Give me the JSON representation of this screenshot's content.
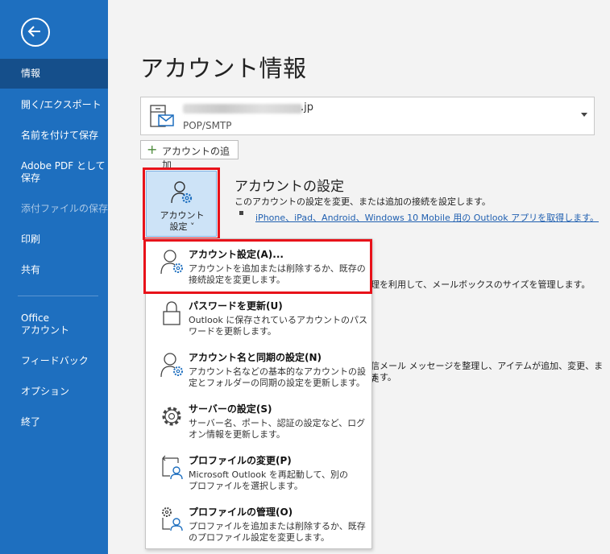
{
  "sidebar": {
    "items": [
      {
        "label": "情報"
      },
      {
        "label": "開く/エクスポート"
      },
      {
        "label": "名前を付けて保存"
      },
      {
        "label": "Adobe PDF として",
        "label2": "保存"
      },
      {
        "label": "添付ファイルの保存"
      },
      {
        "label": "印刷"
      },
      {
        "label": "共有"
      },
      {
        "label": "Office",
        "label2": "アカウント"
      },
      {
        "label": "フィードバック"
      },
      {
        "label": "オプション"
      },
      {
        "label": "終了"
      }
    ]
  },
  "main": {
    "title": "アカウント情報",
    "account": {
      "email_suffix": ".jp",
      "type": "POP/SMTP"
    },
    "add_account": "アカウントの追加",
    "settings_button": {
      "line1": "アカウント",
      "line2": "設定 ˅"
    },
    "section": {
      "title": "アカウントの設定",
      "description": "このアカウントの設定を変更、または追加の接続を設定します。",
      "link": "iPhone、iPad、Android、Windows 10 Mobile 用の Outlook アプリを取得します。"
    },
    "background_texts": {
      "t1": "理を利用して、メールボックスのサイズを管理します。",
      "t2": "信メール メッセージを整理し、アイテムが追加、変更、また",
      "t3": "ます。"
    }
  },
  "menu": {
    "items": [
      {
        "title": "アカウント設定(A)...",
        "d1": "アカウントを追加または削除するか、既存の",
        "d2": "接続設定を変更します。"
      },
      {
        "title": "パスワードを更新(U)",
        "d1": "Outlook に保存されているアカウントのパス",
        "d2": "ワードを更新します。"
      },
      {
        "title": "アカウント名と同期の設定(N)",
        "d1": "アカウント名などの基本的なアカウントの設",
        "d2": "定とフォルダーの同期の設定を更新します。"
      },
      {
        "title": "サーバーの設定(S)",
        "d1": "サーバー名、ポート、認証の設定など、ログ",
        "d2": "オン情報を更新します。"
      },
      {
        "title": "プロファイルの変更(P)",
        "d1": "Microsoft Outlook を再起動して、別の",
        "d2": "プロファイルを選択します。"
      },
      {
        "title": "プロファイルの管理(O)",
        "d1": "プロファイルを追加または削除するか、既存",
        "d2": "のプロファイル設定を変更します。"
      }
    ]
  },
  "colors": {
    "sidebar": "#1e6fbf",
    "sidebar_active": "#154f8b",
    "highlight": "#e8121a",
    "link": "#1f5fb0"
  }
}
